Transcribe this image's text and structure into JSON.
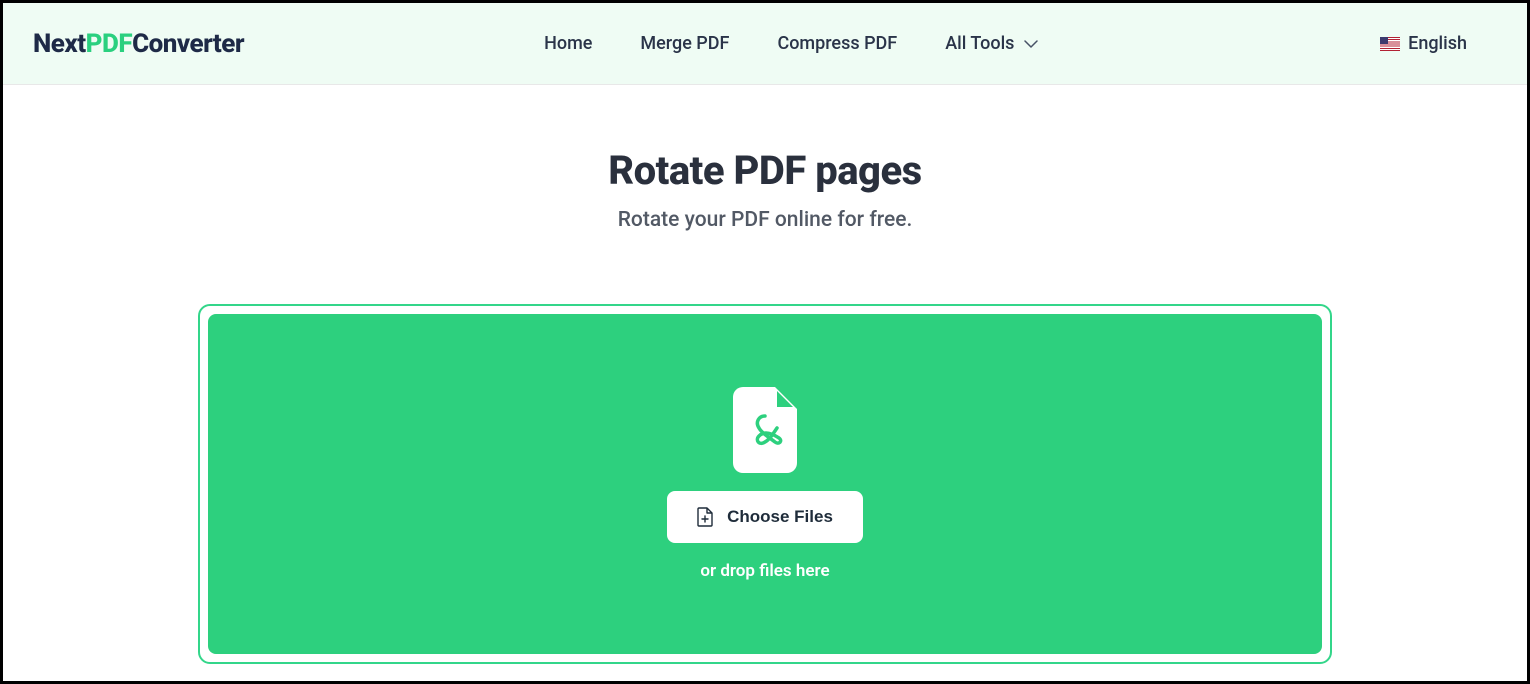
{
  "header": {
    "logo": {
      "part1": "Next",
      "part2": "PDF",
      "part3": "Converter"
    },
    "nav": {
      "home": "Home",
      "merge": "Merge PDF",
      "compress": "Compress PDF",
      "all_tools": "All Tools"
    },
    "language": {
      "label": "English"
    }
  },
  "main": {
    "title": "Rotate PDF pages",
    "subtitle": "Rotate your PDF online for free.",
    "upload": {
      "button_label": "Choose Files",
      "drop_hint": "or drop files here"
    }
  }
}
